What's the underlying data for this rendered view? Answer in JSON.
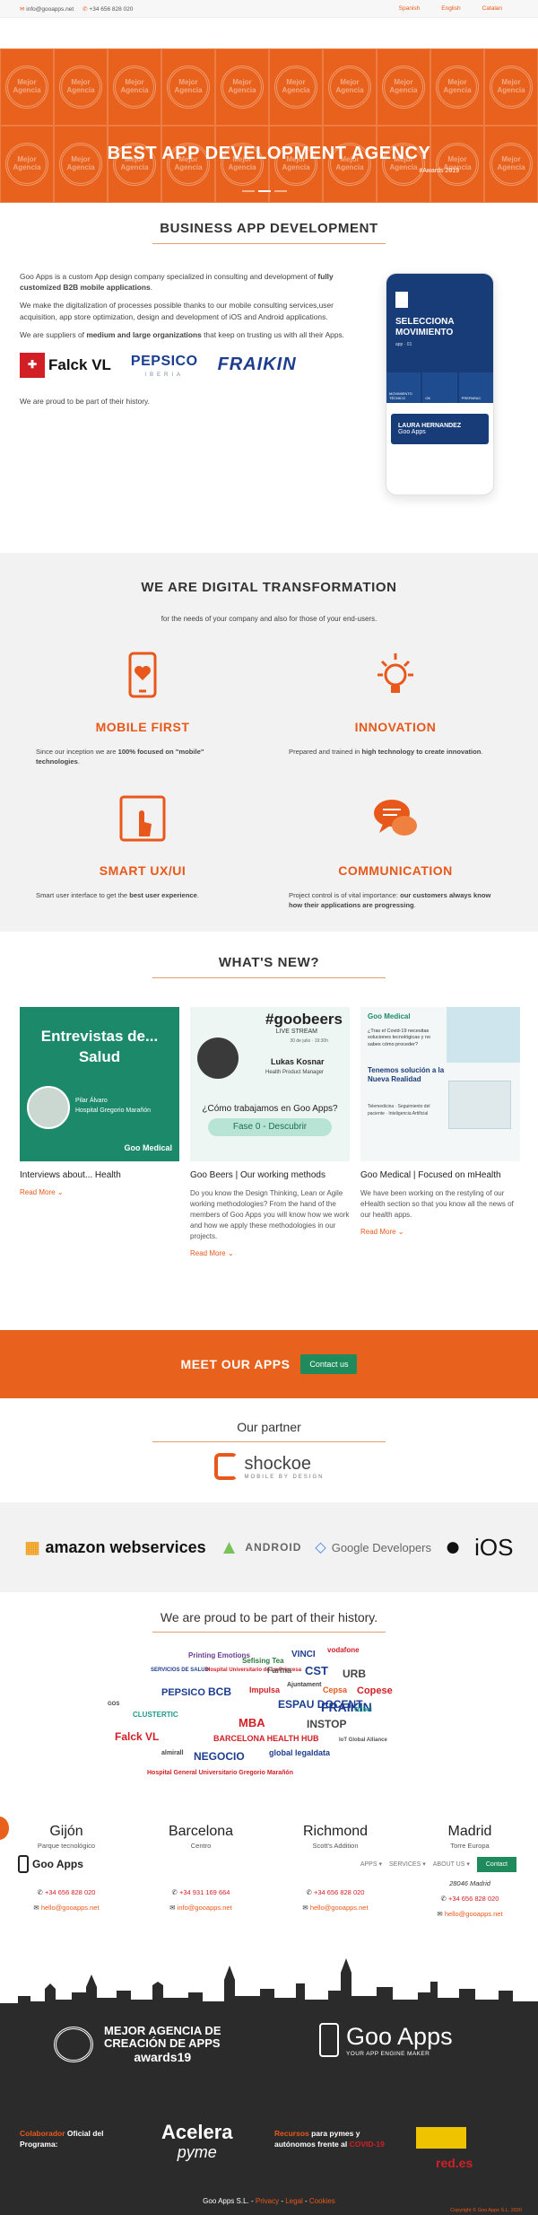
{
  "topbar": {
    "email": "info@gooapps.net",
    "phone": "+34 656 828 020",
    "languages": [
      "Spanish",
      "English",
      "Catalan"
    ]
  },
  "hero": {
    "tile_text": "Mejor Agencia",
    "title": "BEST APP DEVELOPMENT AGENCY",
    "subtitle": "#Awards 2019"
  },
  "business": {
    "title": "BUSINESS APP DEVELOPMENT",
    "p1_a": "Goo Apps is a custom App design company specialized in consulting and development of ",
    "p1_b": "fully customized B2B mobile applications",
    "p1_c": ".",
    "p2": "We make the digitalization of processes possible thanks to our mobile consulting services,user acquisition, app store optimization, design and development of iOS and Android applications.",
    "p3_a": "We are suppliers of ",
    "p3_b": "medium and large organizations",
    "p3_c": " that keep on trusting us with all their Apps.",
    "p4": "We are proud to be part of their history.",
    "logos": {
      "falck": "Falck VL",
      "pepsico": "PEPSICO",
      "pepsico_sub": "IBERIA",
      "fraikin": "FRAIKIN"
    },
    "phone": {
      "title": "SELECCIONA MOVIMIENTO",
      "subtitle": "app · 01",
      "tiles": [
        "MOVIMIENTO TÉCNICO",
        "OK",
        "PREPARAC"
      ],
      "card_name": "LAURA HERNANDEZ",
      "card_sub": "Goo Apps"
    }
  },
  "digital": {
    "title": "WE ARE DIGITAL TRANSFORMATION",
    "lead": "for the needs of your company and also for those of your end-users.",
    "features": [
      {
        "title": "MOBILE FIRST",
        "a": "Since our inception we are ",
        "b": "100% focused on \"mobile\" technologies",
        "c": "."
      },
      {
        "title": "INNOVATION",
        "a": "Prepared and trained in ",
        "b": "high technology to create innovation",
        "c": "."
      },
      {
        "title": "SMART UX/UI",
        "a": "Smart user interface to get the ",
        "b": "best user experience",
        "c": "."
      },
      {
        "title": "COMMUNICATION",
        "a": "Project control is of vital importance: ",
        "b": "our customers always know how their applications are progressing",
        "c": "."
      }
    ]
  },
  "news": {
    "title": "WHAT'S NEW?",
    "cards": [
      {
        "img_title": "Entrevistas de... Salud",
        "img_person": "Pilar Álvaro",
        "img_role": "Hospital Gregorio Marañón",
        "img_brand": "Goo Medical",
        "title": "Interviews about... Health",
        "text": "",
        "more": "Read More"
      },
      {
        "img_title": "#goobeers",
        "img_live": "LIVE STREAM",
        "img_date": "30 de julio · 19:30h",
        "img_person": "Lukas Kosnar",
        "img_role": "Health Product Manager",
        "img_question": "¿Cómo trabajamos en Goo Apps?",
        "img_phase": "Fase 0 - Descubrir",
        "title": "Goo Beers | Our working methods",
        "text": "Do you know the Design Thinking, Lean or Agile working methodologies? From the hand of the members of Goo Apps you will know how we work and how we apply these methodologies in our projects.",
        "more": "Read More"
      },
      {
        "img_brand": "Goo Medical",
        "img_q": "¿Tras el Covid-19 necesitas soluciones tecnológicas y no sabes cómo proceder?",
        "img_sol": "Tenemos solución a la Nueva Realidad",
        "img_list": "Telemedicina · Seguimiento del paciente · Inteligencia Artificial",
        "title": "Goo Medical | Focused on mHealth",
        "text": "We have been working on the restyling of our eHealth section so that you know all the news of our health apps.",
        "more": "Read More"
      }
    ]
  },
  "meet": {
    "label": "MEET OUR APPS",
    "button": "Contact us"
  },
  "partner": {
    "title": "Our partner",
    "name": "shockoe",
    "tagline": "MOBILE BY DESIGN"
  },
  "platforms": [
    "amazon webservices",
    "ANDROID",
    "Google Developers",
    "",
    "iOS"
  ],
  "proud": {
    "title": "We are proud to be part of their history.",
    "logos": [
      "Printing Emotions",
      "Sefising Tea",
      "VINCI",
      "vodafone",
      "SERVICIOS DE SALUD",
      "Hospital Universitario de La Princesa",
      "Farma",
      "CST",
      "URB",
      "PEPSICO",
      "BCB",
      "Impulsa",
      "Ajuntament",
      "Cepsa",
      "Copese",
      "GOS",
      "FRAIKIN",
      "ESPAU DOCENT",
      "CLUSTERTIC",
      "MBA",
      "INSTOP",
      "Ofibei",
      "Falck VL",
      "BARCELONA HEALTH HUB",
      "NEGOCIO",
      "global legaldata",
      "almirall",
      "IoT Global Alliance",
      "Hospital General Universitario Gregorio Marañón"
    ]
  },
  "offices": [
    {
      "city": "Gijón",
      "area": "Parque tecnológico",
      "line": "",
      "phone": "+34 656 828 020",
      "email": "hello@gooapps.net"
    },
    {
      "city": "Barcelona",
      "area": "Centro",
      "line": "",
      "phone": "+34 931 169 664",
      "email": "info@gooapps.net"
    },
    {
      "city": "Richmond",
      "area": "Scott's Addition",
      "line": "",
      "phone": "+34 656 828 020",
      "email": "hello@gooapps.net"
    },
    {
      "city": "Madrid",
      "area": "Torre Europa",
      "line": "28046 Madrid",
      "phone": "+34 656 828 020",
      "email": "hello@gooapps.net"
    }
  ],
  "navbar": {
    "logo": "Goo Apps",
    "logo_sub": "YOUR APP ENGINE MAKER",
    "items": [
      "APPS",
      "SERVICES",
      "ABOUT US"
    ],
    "contact": "Contact"
  },
  "footer": {
    "award_l1": "MEJOR AGENCIA DE",
    "award_l2": "CREACIÓN DE APPS",
    "award_l3": "awards19",
    "brand": "Goo Apps",
    "brand_sub": "YOUR APP ENGINE MAKER",
    "collab_o": "Colaborador",
    "collab_w1": " Oficial del",
    "collab_w2": "Programa:",
    "acelera": "Acelera",
    "pyme": "pyme",
    "rec_o1": "Recursos",
    "rec_w1": " para pymes y",
    "rec_w2": "autónomos frente al ",
    "rec_o2": "COVID-19",
    "redes": "red.es",
    "legal_a": "Goo Apps S.L. - ",
    "legal_links": [
      "Privacy",
      "Legal",
      "Cookies"
    ],
    "copyright": "Copyright © Goo Apps S.L. 2020"
  },
  "colors": {
    "accent": "#e8621d",
    "green": "#1f8a5b",
    "navy": "#183c77",
    "dark": "#2b2b2b"
  }
}
